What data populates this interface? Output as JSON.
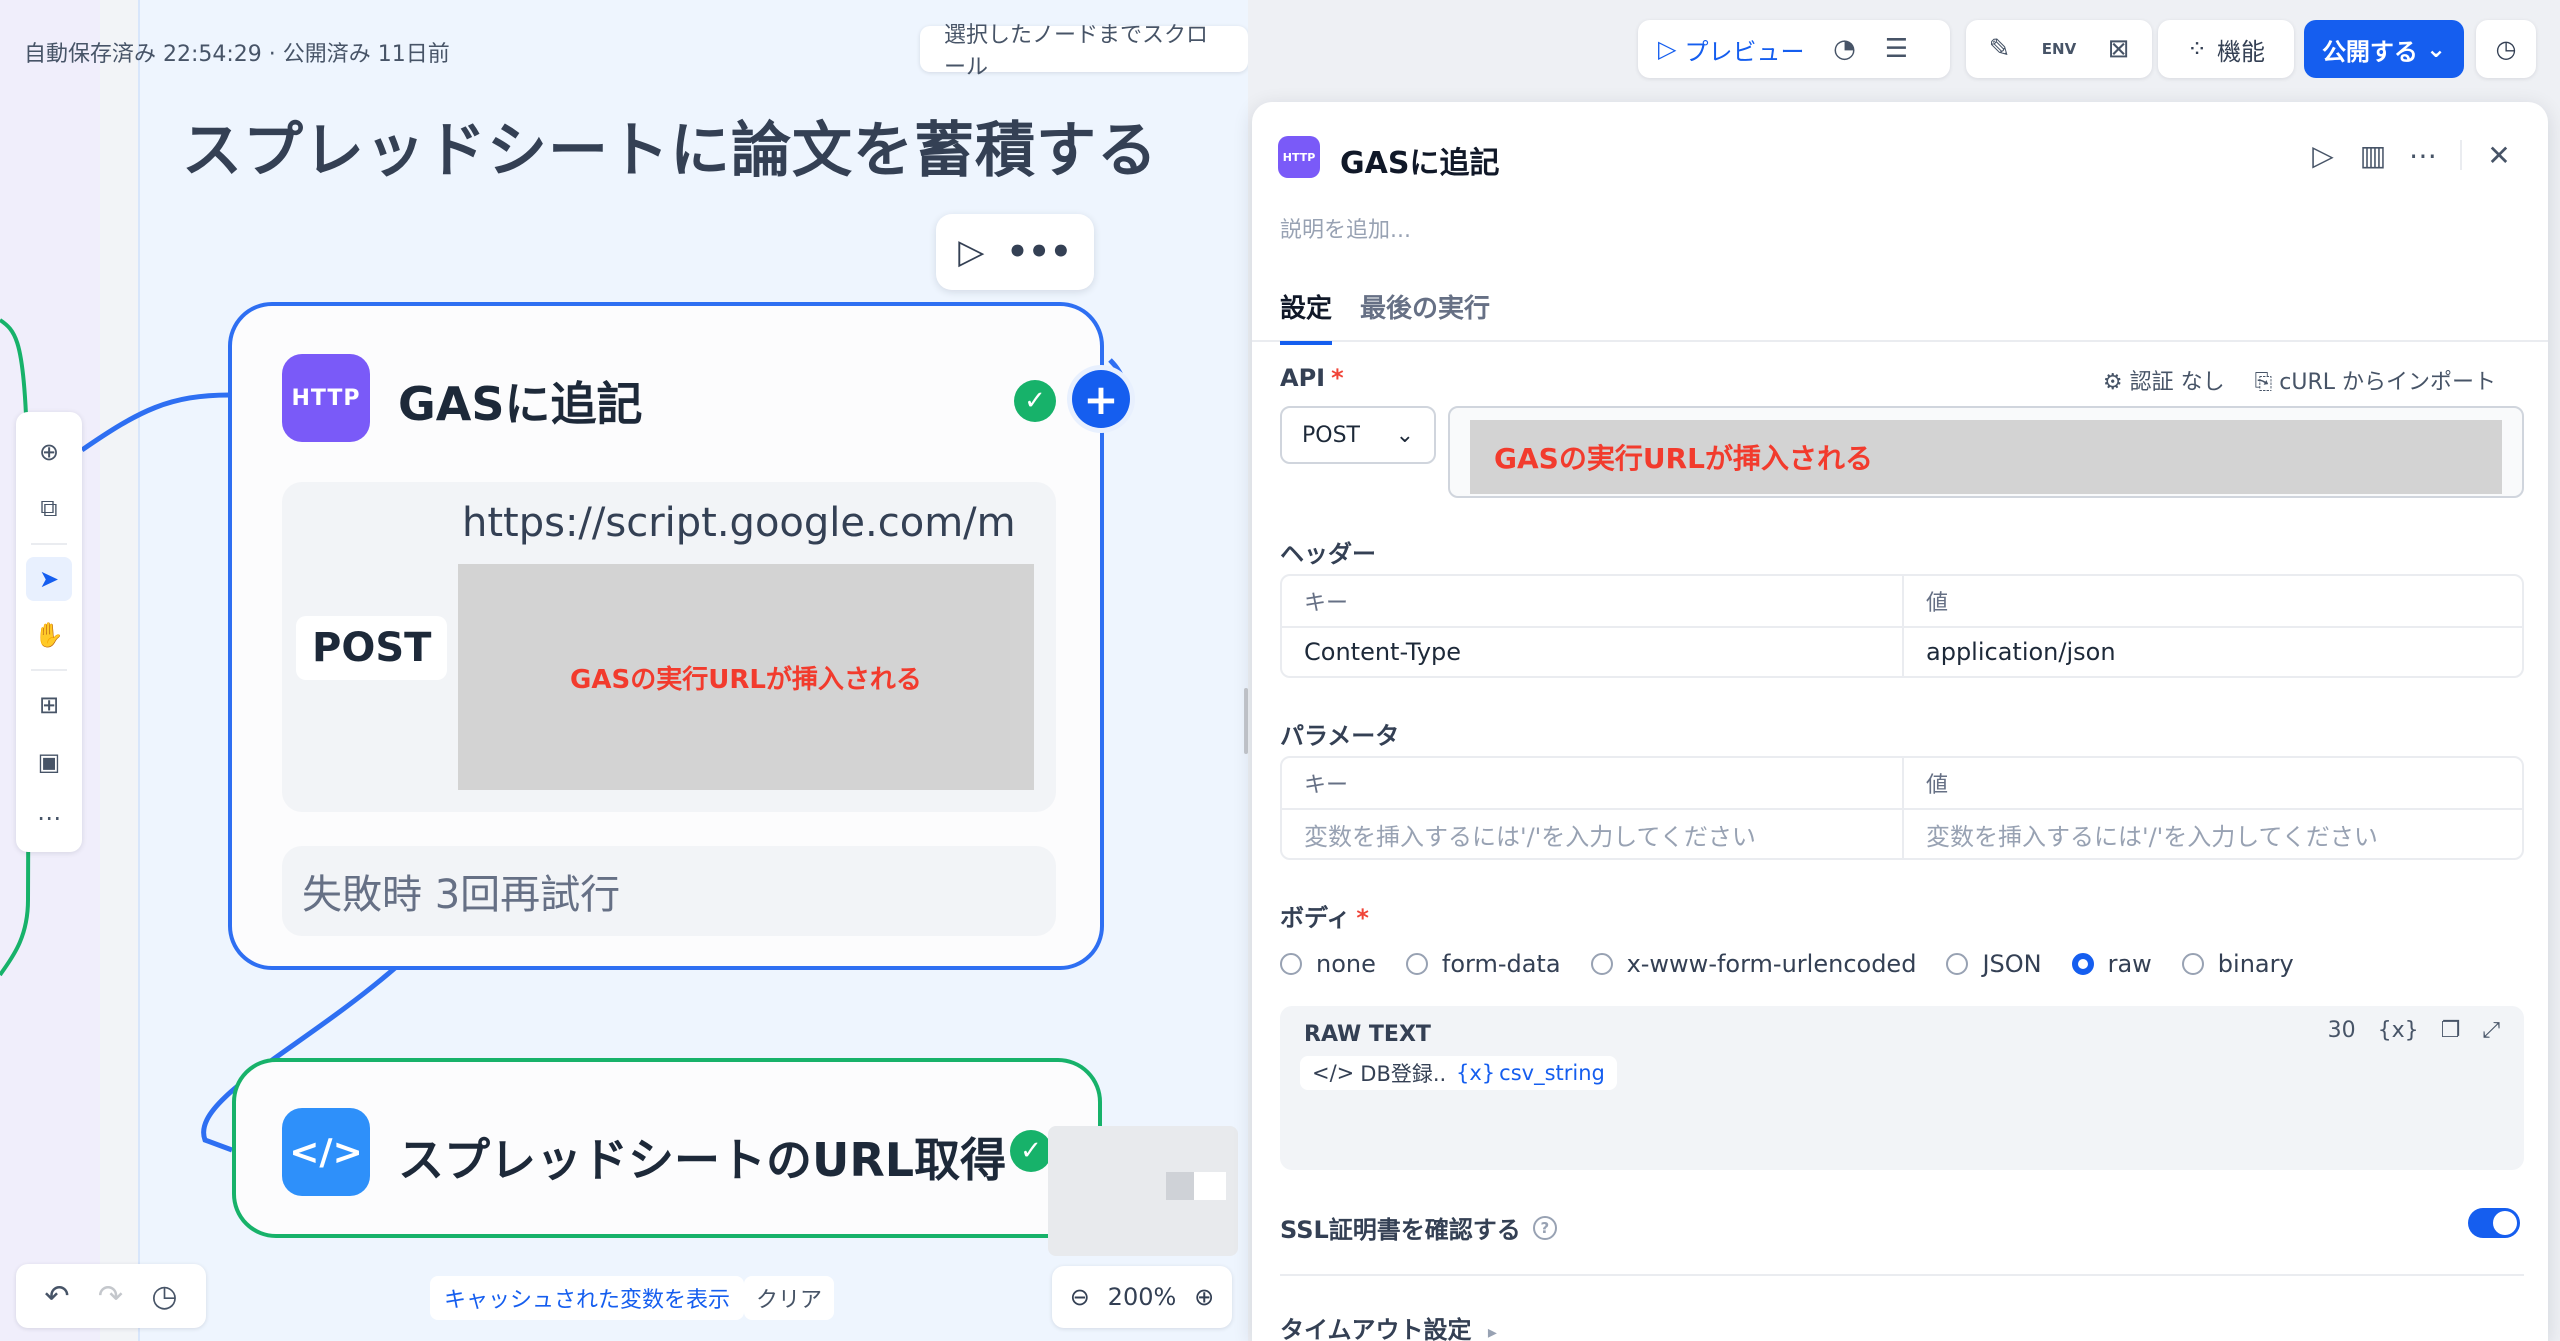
{
  "canvas": {
    "status_line": "自動保存済み 22:54:29 · 公開済み 11日前",
    "scroll_to_node": "選択したノードまでスクロール",
    "group_title": "スプレッドシートに論文を蓄積する",
    "cache_vars": "キャッシュされた変数を表示",
    "clear": "クリア",
    "zoom": "200%"
  },
  "http_node": {
    "icon_text": "HTTP",
    "title": "GASに追記",
    "url": "https://script.google.com/m",
    "method": "POST",
    "redaction_note": "GASの実行URLが挿入される",
    "retry": "失敗時 3回再試行"
  },
  "code_node": {
    "icon_text": "</>",
    "title": "スプレッドシートのURL取得"
  },
  "toolbar": {
    "preview": "プレビュー",
    "features": "機能",
    "publish": "公開する",
    "env_label": "ENV"
  },
  "panel": {
    "icon_text": "HTTP",
    "title": "GASに追記",
    "description_placeholder": "説明を追加...",
    "tabs": [
      "設定",
      "最後の実行"
    ],
    "api_label": "API",
    "auth": "認証 なし",
    "curl_import": "cURL からインポート",
    "method": "POST",
    "url_redaction_note": "GASの実行URLが挿入される",
    "headers_label": "ヘッダー",
    "headers_table": {
      "key_header": "キー",
      "value_header": "値",
      "rows": [
        [
          "Content-Type",
          "application/json"
        ]
      ]
    },
    "params_label": "パラメータ",
    "params_table": {
      "key_header": "キー",
      "value_header": "値",
      "key_placeholder": "変数を挿入するには'/'を入力してください",
      "value_placeholder": "変数を挿入するには'/'を入力してください"
    },
    "body_label": "ボディ",
    "body_types": [
      "none",
      "form-data",
      "x-www-form-urlencoded",
      "JSON",
      "raw",
      "binary"
    ],
    "body_selected": "raw",
    "raw_title": "RAW TEXT",
    "raw_count": "30",
    "raw_var_node": "DB登録...",
    "raw_var_name": "csv_string",
    "ssl_label": "SSL証明書を確認する",
    "ssl_enabled": true,
    "timeout_label": "タイムアウト設定"
  },
  "colors": {
    "accent": "#155eef",
    "http_icon": "#7a5af8",
    "code_icon": "#2e90fa",
    "success": "#17b26a",
    "redaction_text": "#f23b2d"
  }
}
